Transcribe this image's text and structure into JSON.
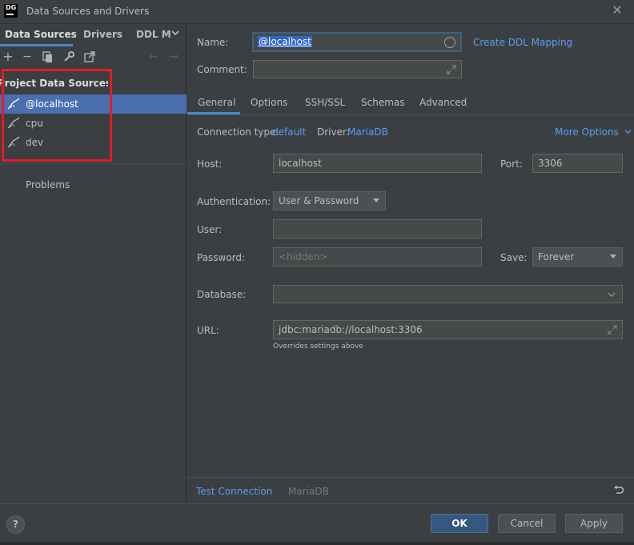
{
  "window": {
    "title": "Data Sources and Drivers",
    "logo": "DG"
  },
  "left": {
    "tabs": [
      "Data Sources",
      "Drivers",
      "DDL M"
    ],
    "section_title": "Project Data Sources",
    "items": [
      {
        "label": "@localhost",
        "selected": true
      },
      {
        "label": "cpu",
        "selected": false
      },
      {
        "label": "dev",
        "selected": false
      }
    ],
    "problems": "Problems"
  },
  "form": {
    "name_label": "Name:",
    "name_value": "@localhost",
    "ddl_link": "Create DDL Mapping",
    "comment_label": "Comment:",
    "tabs": [
      "General",
      "Options",
      "SSH/SSL",
      "Schemas",
      "Advanced"
    ],
    "conn_type_label": "Connection type:",
    "conn_type_value": "default",
    "driver_label": "Driver:",
    "driver_value": "MariaDB",
    "more_options": "More Options",
    "host_label": "Host:",
    "host_value": "localhost",
    "port_label": "Port:",
    "port_value": "3306",
    "auth_label": "Authentication:",
    "auth_value": "User & Password",
    "user_label": "User:",
    "password_label": "Password:",
    "password_placeholder": "<hidden>",
    "save_label": "Save:",
    "save_value": "Forever",
    "database_label": "Database:",
    "url_label": "URL:",
    "url_value": "jdbc:mariadb://localhost:3306",
    "url_hint": "Overrides settings above"
  },
  "bottom": {
    "test_connection": "Test Connection",
    "driver_name": "MariaDB"
  },
  "footer": {
    "help": "?",
    "ok": "OK",
    "cancel": "Cancel",
    "apply": "Apply"
  },
  "colors": {
    "accent": "#4a88c7",
    "selection": "#4b6eaf",
    "link": "#589df6",
    "highlight_box": "#e11c2a"
  }
}
